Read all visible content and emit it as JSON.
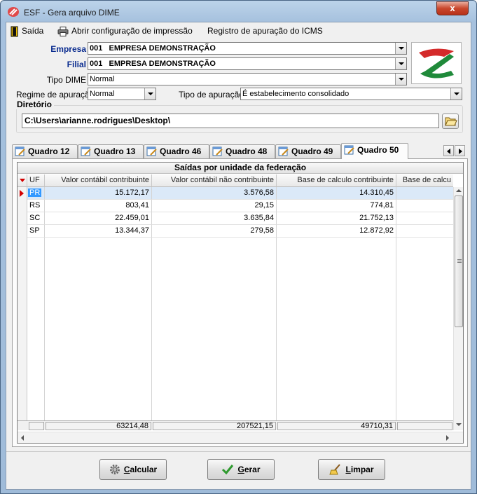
{
  "window": {
    "title": "ESF - Gera arquivo DIME",
    "close_glyph": "x"
  },
  "menu": [
    {
      "label": "Saída",
      "icon": "exit-door-icon"
    },
    {
      "label": "Abrir configuração de impressão",
      "icon": "printer-icon"
    },
    {
      "label": "Registro de apuração do ICMS"
    }
  ],
  "form": {
    "empresa": {
      "label": "Empresa",
      "code": "001",
      "name": "EMPRESA DEMONSTRAÇÃO"
    },
    "filial": {
      "label": "Filial",
      "code": "001",
      "name": "EMPRESA DEMONSTRAÇÃO"
    },
    "tipo_dime": {
      "label": "Tipo DIME",
      "value": "Normal"
    },
    "regime": {
      "label": "Regime de apuração",
      "value": "Normal"
    },
    "tipo_apuracao": {
      "label": "Tipo de apuração",
      "value": "É estabelecimento consolidado"
    },
    "diretorio": {
      "label": "Diretório",
      "value": "C:\\Users\\arianne.rodrigues\\Desktop\\"
    }
  },
  "tabs": [
    {
      "label": "Quadro 12",
      "active": false
    },
    {
      "label": "Quadro 13",
      "active": false
    },
    {
      "label": "Quadro 46",
      "active": false
    },
    {
      "label": "Quadro 48",
      "active": false
    },
    {
      "label": "Quadro 49",
      "active": false
    },
    {
      "label": "Quadro 50",
      "active": true
    }
  ],
  "grid": {
    "title": "Saídas por unidade da federação",
    "columns": [
      "UF",
      "Valor contábil contribuinte",
      "Valor contábil não contribuinte",
      "Base de calculo contribuinte",
      "Base de calcu"
    ],
    "rows": [
      [
        "PR",
        "15.172,17",
        "3.576,58",
        "14.310,45",
        ""
      ],
      [
        "RS",
        "803,41",
        "29,15",
        "774,81",
        ""
      ],
      [
        "SC",
        "22.459,01",
        "3.635,84",
        "21.752,13",
        ""
      ],
      [
        "SP",
        "13.344,37",
        "279,58",
        "12.872,92",
        ""
      ]
    ],
    "selected_row": 0,
    "totals": [
      "",
      "63214,48",
      "207521,15",
      "49710,31",
      ""
    ]
  },
  "buttons": {
    "calcular": {
      "first": "C",
      "rest": "alcular"
    },
    "gerar": {
      "first": "G",
      "rest": "erar"
    },
    "limpar": {
      "first": "L",
      "rest": "impar"
    }
  },
  "colors": {
    "accent_blue": "#0a2c8f",
    "selection": "#3399ff",
    "indicator": "#d40000",
    "logo_green": "#1f8a3a",
    "logo_red": "#d42a2a"
  }
}
